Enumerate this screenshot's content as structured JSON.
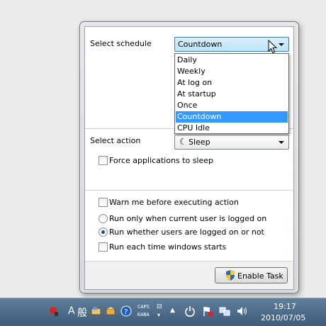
{
  "schedule": {
    "label": "Select  schedule",
    "selected": "Countdown",
    "options": [
      "Daily",
      "Weekly",
      "At log on",
      "At startup",
      "Once",
      "Countdown",
      "CPU Idle"
    ],
    "selected_index": 5
  },
  "action": {
    "label": "Select  action",
    "selected": "Sleep",
    "icon": "moon-icon"
  },
  "options": {
    "force_apps": "Force applications to sleep",
    "warn": "Warn me before executing action",
    "run_current_user": "Run only when current user is logged on",
    "run_whether": "Run whether users are logged on or not",
    "run_each_start": "Run each time windows starts"
  },
  "enable_button": "Enable Task",
  "taskbar": {
    "ime_a": "A",
    "ime_kanji": "般",
    "caps": "CAPS",
    "kana": "KANA",
    "time": "19:17",
    "date": "2010/07/05"
  },
  "colors": {
    "highlight": "#3399ff",
    "taskbar": "#4a6a89"
  }
}
